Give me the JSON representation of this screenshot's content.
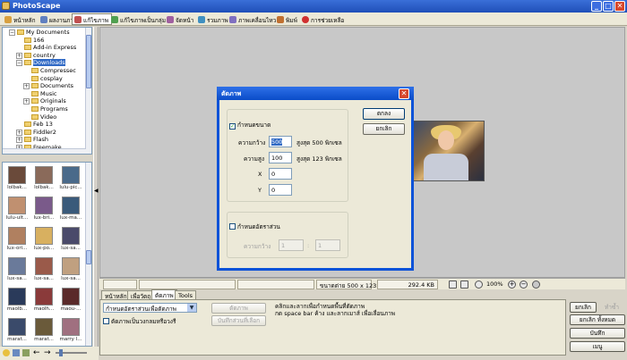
{
  "window": {
    "title": "PhotoScape",
    "minimize": "_",
    "maximize": "□",
    "close": "✕"
  },
  "tabs": [
    {
      "label": "หน้าหลัก",
      "icon": "home-icon",
      "color": "#d8a040"
    },
    {
      "label": "ผลงานภาพ",
      "icon": "viewer-icon",
      "color": "#6080c0"
    },
    {
      "label": "แก้ไขภาพ",
      "icon": "editor-icon",
      "color": "#c05050"
    },
    {
      "label": "แก้ไขภาพเป็นกลุ่ม",
      "icon": "batch-editor-icon",
      "color": "#50a050"
    },
    {
      "label": "จัดหน้า",
      "icon": "page-icon",
      "color": "#a060a0"
    },
    {
      "label": "รวมภาพ",
      "icon": "combine-icon",
      "color": "#4090c0"
    },
    {
      "label": "ภาพเคลื่อนไหว",
      "icon": "animated-gif-icon",
      "color": "#8070c0"
    },
    {
      "label": "พิมพ์",
      "icon": "print-icon",
      "color": "#c07030"
    },
    {
      "label": "การช่วยเหลือ",
      "icon": "help-icon",
      "color": "#d03030"
    }
  ],
  "tree": [
    {
      "label": "My Documents",
      "indent": 0,
      "pm": "−"
    },
    {
      "label": "166",
      "indent": 1,
      "pm": ""
    },
    {
      "label": "Add-in Express",
      "indent": 1,
      "pm": ""
    },
    {
      "label": "country",
      "indent": 1,
      "pm": "+"
    },
    {
      "label": "Downloads",
      "indent": 1,
      "pm": "−",
      "selected": true
    },
    {
      "label": "Compressec",
      "indent": 2,
      "pm": ""
    },
    {
      "label": "cosplay",
      "indent": 2,
      "pm": ""
    },
    {
      "label": "Documents",
      "indent": 2,
      "pm": "+"
    },
    {
      "label": "Music",
      "indent": 2,
      "pm": ""
    },
    {
      "label": "Originals",
      "indent": 2,
      "pm": "+"
    },
    {
      "label": "Programs",
      "indent": 2,
      "pm": ""
    },
    {
      "label": "Video",
      "indent": 2,
      "pm": ""
    },
    {
      "label": "Feb 13",
      "indent": 1,
      "pm": ""
    },
    {
      "label": "Fiddler2",
      "indent": 1,
      "pm": "+"
    },
    {
      "label": "Flash",
      "indent": 1,
      "pm": "+"
    },
    {
      "label": "Freemake",
      "indent": 1,
      "pm": "+"
    }
  ],
  "thumbnails": [
    {
      "label": "lolbak...",
      "color": "#6a4a3a"
    },
    {
      "label": "lolbak...",
      "color": "#8a6a5a"
    },
    {
      "label": "lulu-pic...",
      "color": "#4a6a8a"
    },
    {
      "label": "lulu-ult...",
      "color": "#c09070"
    },
    {
      "label": "lux-bri...",
      "color": "#7a5a8a"
    },
    {
      "label": "lux-ma...",
      "color": "#3a5a7a"
    },
    {
      "label": "lux-ori...",
      "color": "#b08060"
    },
    {
      "label": "lux-po...",
      "color": "#d8b060"
    },
    {
      "label": "lux-sa...",
      "color": "#4a4a6a"
    },
    {
      "label": "lux-sa...",
      "color": "#6a7a9a"
    },
    {
      "label": "lux-sa...",
      "color": "#9a5a4a"
    },
    {
      "label": "lux-sa...",
      "color": "#c0a080"
    },
    {
      "label": "maolb...",
      "color": "#2a3a5a"
    },
    {
      "label": "maolh...",
      "color": "#8a3a3a"
    },
    {
      "label": "maou-...",
      "color": "#5a2a2a"
    },
    {
      "label": "marat...",
      "color": "#3a4a6a"
    },
    {
      "label": "marat...",
      "color": "#6a5a3a"
    },
    {
      "label": "marry l...",
      "color": "#a07080"
    }
  ],
  "status": {
    "size": "ขนาดต่าย 500 x 123",
    "filesize": "292.4 KB",
    "zoom": "100%"
  },
  "bottom_tabs": [
    "หน้าหลัก",
    "เพื่อวัตถุ",
    "ตัดภาพ",
    "Tools"
  ],
  "crop_panel": {
    "combo_value": "กำหนดอัตราส่วนเพื่อตัดภาพ",
    "crop_btn": "ตัดภาพ",
    "save_btn": "บันทึกส่วนที่เลือก",
    "checkbox": "ตัดภาพเป็นวงกลมหรือวงรี",
    "help_line1": "คลิกและลากเพื่อกำหนดพื้นที่ตัดภาพ",
    "help_line2": "กด space bar ค้าง และลากเมาส์ เพื่อเลื่อนภาพ"
  },
  "right_buttons": {
    "undo": "ยกเลิก",
    "redo": "ทำซ้ำ",
    "undo_all": "ยกเลิก ทั้งหมด",
    "save": "บันทึก",
    "menu": "เมนู"
  },
  "dialog": {
    "title": "ตัดภาพ",
    "size_checkbox": "กำหนดขนาด",
    "width_label": "ความกว้าง",
    "width_value": "500",
    "width_max": "สูงสุด 500 พิกเซล",
    "height_label": "ความสูง",
    "height_value": "100",
    "height_max": "สูงสุด 123 พิกเซล",
    "x_label": "X",
    "x_value": "0",
    "y_label": "Y",
    "y_value": "0",
    "ratio_checkbox": "กำหนดอัตราส่วน",
    "ratio_label": "ความกว้าง",
    "ratio_w": "1",
    "ratio_sep": ":",
    "ratio_h": "1",
    "ok": "ตกลง",
    "cancel": "ยกเลิก"
  }
}
